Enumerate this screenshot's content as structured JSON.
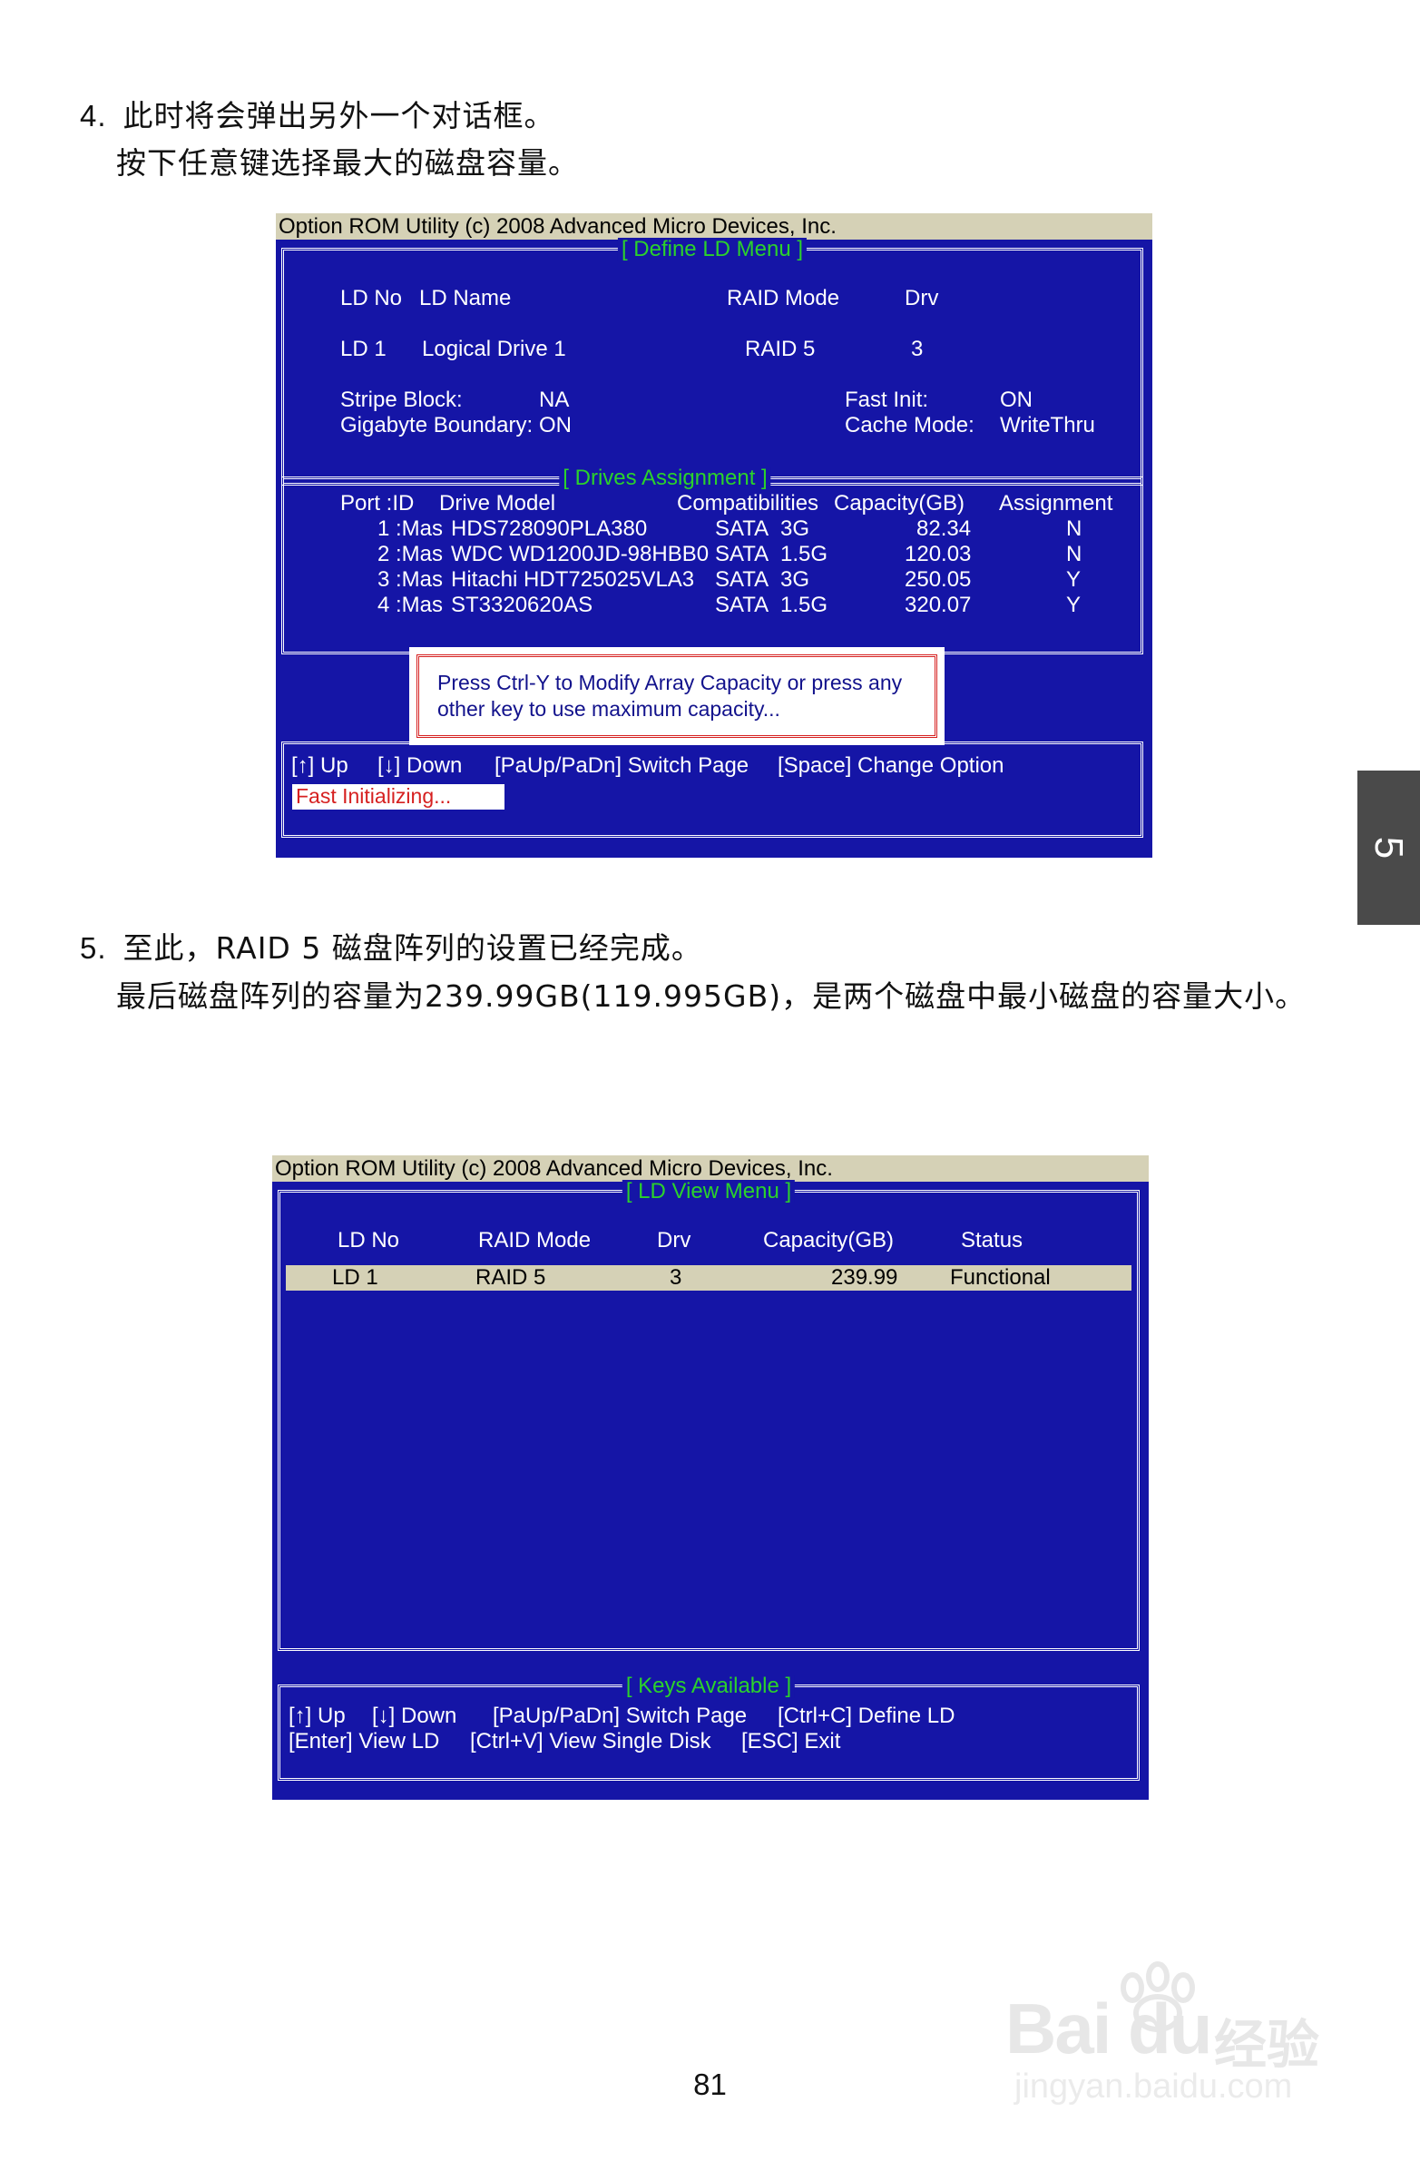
{
  "step4": {
    "number": "4.",
    "line1": "此时将会弹出另外一个对话框。",
    "line2": "按下任意键选择最大的磁盘容量。"
  },
  "screen1": {
    "title": "Option ROM Utility (c) 2008 Advanced Micro Devices, Inc.",
    "define_menu_title": "[ Define LD Menu ]",
    "ld_headers": {
      "ld_no": "LD No",
      "ld_name": "LD Name",
      "raid_mode": "RAID Mode",
      "drv": "Drv"
    },
    "ld_row": {
      "ld_no": "LD  1",
      "ld_name": "Logical Drive 1",
      "raid_mode": "RAID 5",
      "drv": "3"
    },
    "stripe_block_label": "Stripe Block:",
    "stripe_block_value": "NA",
    "gigabyte_boundary_label": "Gigabyte Boundary:",
    "gigabyte_boundary_value": "ON",
    "fast_init_label": "Fast Init:",
    "fast_init_value": "ON",
    "cache_mode_label": "Cache Mode:",
    "cache_mode_value": "WriteThru",
    "drives_title": "[ Drives Assignment ]",
    "drive_headers": {
      "port_id": "Port  :ID",
      "model": "Drive Model",
      "compat": "Compatibilities",
      "capacity": "Capacity(GB)",
      "assignment": "Assignment"
    },
    "drives": [
      {
        "port": "1 :Mas",
        "model": "HDS728090PLA380",
        "sata": "SATA",
        "speed": "3G",
        "capacity": "82.34",
        "assignment": "N"
      },
      {
        "port": "2 :Mas",
        "model": "WDC WD1200JD-98HBB0",
        "sata": "SATA",
        "speed": "1.5G",
        "capacity": "120.03",
        "assignment": "N"
      },
      {
        "port": "3 :Mas",
        "model": "Hitachi HDT725025VLA3",
        "sata": "SATA",
        "speed": "3G",
        "capacity": "250.05",
        "assignment": "Y"
      },
      {
        "port": "4 :Mas",
        "model": "ST3320620AS",
        "sata": "SATA",
        "speed": "1.5G",
        "capacity": "320.07",
        "assignment": "Y"
      }
    ],
    "popup_line1": "Press Ctrl-Y to Modify Array Capacity or press any",
    "popup_line2": "other key to use maximum capacity...",
    "keys": {
      "up": "[↑] Up",
      "down": "[↓] Down",
      "page": "[PaUp/PaDn] Switch Page",
      "space": "[Space] Change Option"
    },
    "status": "Fast  Initializing..."
  },
  "side_tab": "5",
  "step5": {
    "number": "5.",
    "line1": "至此，RAID 5 磁盘阵列的设置已经完成。",
    "line2": "最后磁盘阵列的容量为239.99GB(119.995GB)，是两个磁盘中最小磁盘的容量大小。"
  },
  "screen2": {
    "title": "Option ROM Utility (c) 2008 Advanced Micro Devices, Inc.",
    "view_menu_title": "[ LD View Menu ]",
    "headers": {
      "ld_no": "LD No",
      "raid_mode": "RAID Mode",
      "drv": "Drv",
      "capacity": "Capacity(GB)",
      "status": "Status"
    },
    "row": {
      "ld_no": "LD  1",
      "raid_mode": "RAID 5",
      "drv": "3",
      "capacity": "239.99",
      "status": "Functional"
    },
    "keys_title": "[ Keys Available ]",
    "keys_line1": {
      "up": "[↑] Up",
      "down": "[↓] Down",
      "page": "[PaUp/PaDn] Switch Page",
      "define": "[Ctrl+C] Define LD"
    },
    "keys_line2": {
      "view": "[Enter] View LD",
      "single": "[Ctrl+V] View Single Disk",
      "exit": "[ESC] Exit"
    }
  },
  "page_number": "81",
  "watermark": {
    "logo": "Bai du",
    "cn": "经验",
    "url": "jingyan.baidu.com"
  }
}
